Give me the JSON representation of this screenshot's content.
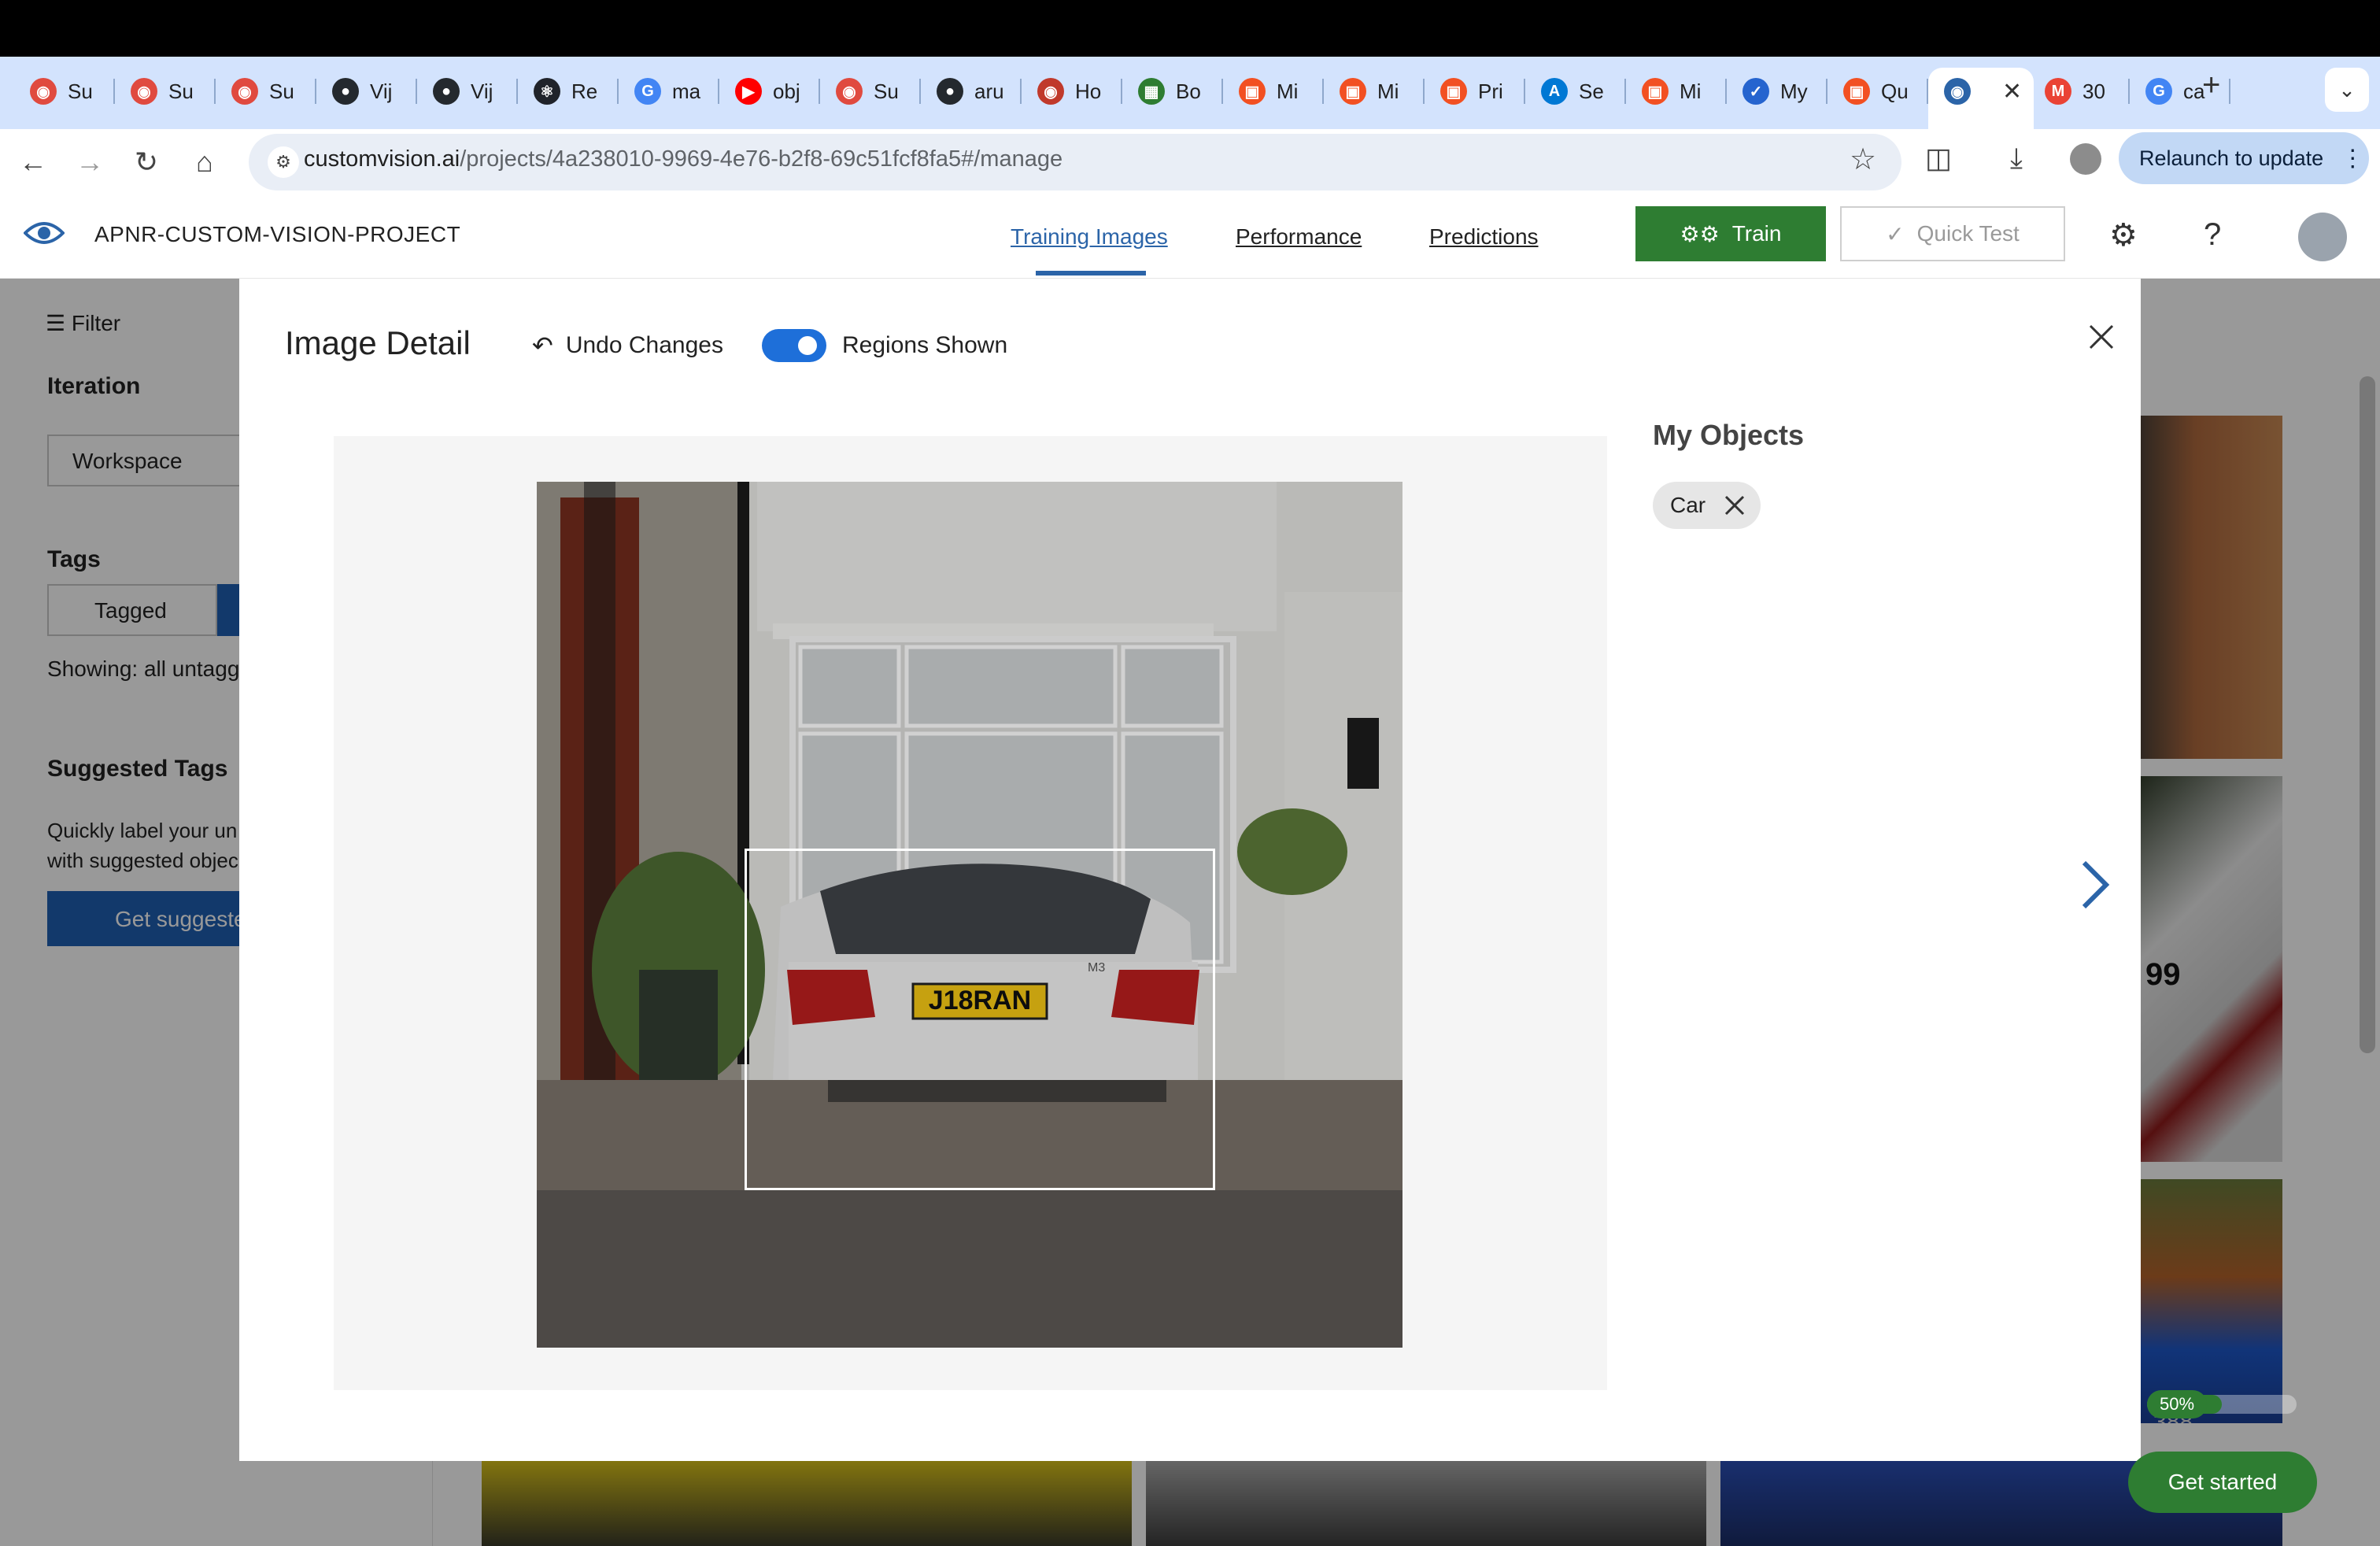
{
  "browser": {
    "tabs": [
      {
        "label": "Su",
        "icon": "copilot-icon",
        "color": "#e04a3f"
      },
      {
        "label": "Su",
        "icon": "copilot-icon",
        "color": "#e04a3f"
      },
      {
        "label": "Su",
        "icon": "copilot-icon",
        "color": "#e04a3f"
      },
      {
        "label": "Vij",
        "icon": "github-icon",
        "color": "#24292e"
      },
      {
        "label": "Vij",
        "icon": "github-icon",
        "color": "#24292e"
      },
      {
        "label": "Re",
        "icon": "react-icon",
        "color": "#20232a"
      },
      {
        "label": "ma",
        "icon": "google-icon",
        "color": "#4285f4"
      },
      {
        "label": "obj",
        "icon": "youtube-icon",
        "color": "#ff0000"
      },
      {
        "label": "Su",
        "icon": "copilot-icon",
        "color": "#e04a3f"
      },
      {
        "label": "aru",
        "icon": "github-icon",
        "color": "#24292e"
      },
      {
        "label": "Ho",
        "icon": "globe-icon",
        "color": "#c0392b"
      },
      {
        "label": "Bo",
        "icon": "book-icon",
        "color": "#2e7d32"
      },
      {
        "label": "Mi",
        "icon": "microsoft-icon",
        "color": "#f25022"
      },
      {
        "label": "Mi",
        "icon": "microsoft-icon",
        "color": "#f25022"
      },
      {
        "label": "Pri",
        "icon": "microsoft-icon",
        "color": "#f25022"
      },
      {
        "label": "Se",
        "icon": "azure-icon",
        "color": "#0078d4"
      },
      {
        "label": "Mi",
        "icon": "microsoft-icon",
        "color": "#f25022"
      },
      {
        "label": "My",
        "icon": "todo-icon",
        "color": "#2564cf"
      },
      {
        "label": "Qu",
        "icon": "microsoft-icon",
        "color": "#f25022"
      },
      {
        "label": "",
        "icon": "custom-vision-icon",
        "color": "#2b64a8",
        "active": true
      },
      {
        "label": "30",
        "icon": "gmail-icon",
        "color": "#ea4335"
      },
      {
        "label": "ca",
        "icon": "google-icon",
        "color": "#4285f4"
      }
    ],
    "url_host": "customvision.ai",
    "url_path": "/projects/4a238010-9969-4e76-b2f8-69c51fcf8fa5#/manage",
    "relaunch_label": "Relaunch to update"
  },
  "app": {
    "project_name": "APNR-CUSTOM-VISION-PROJECT",
    "nav": {
      "training_images": "Training Images",
      "performance": "Performance",
      "predictions": "Predictions"
    },
    "train_label": "Train",
    "quick_test_label": "Quick Test"
  },
  "sidebar": {
    "filter_label": "Filter",
    "iteration_heading": "Iteration",
    "iteration_value": "Workspace",
    "tags_heading": "Tags",
    "tagged_label": "Tagged",
    "showing_text": "Showing: all untagg",
    "suggested_heading": "Suggested Tags",
    "suggested_desc_1": "Quickly label your un",
    "suggested_desc_2": "with suggested objec",
    "suggested_button": "Get suggeste"
  },
  "modal": {
    "title": "Image Detail",
    "undo_label": "Undo Changes",
    "regions_label": "Regions Shown",
    "regions_shown": true,
    "objects_heading": "My Objects",
    "objects": [
      {
        "label": "Car"
      }
    ],
    "plate_text": "J18RAN",
    "car_badge": "M3"
  },
  "background": {
    "badge_text": "388",
    "plate_fragment": "99"
  },
  "progress": {
    "label": "50%",
    "value": 0.5
  },
  "get_started_label": "Get started",
  "colors": {
    "accent": "#2b64a8",
    "train_green": "#2e7d32",
    "toggle_blue": "#1e6fd9"
  }
}
